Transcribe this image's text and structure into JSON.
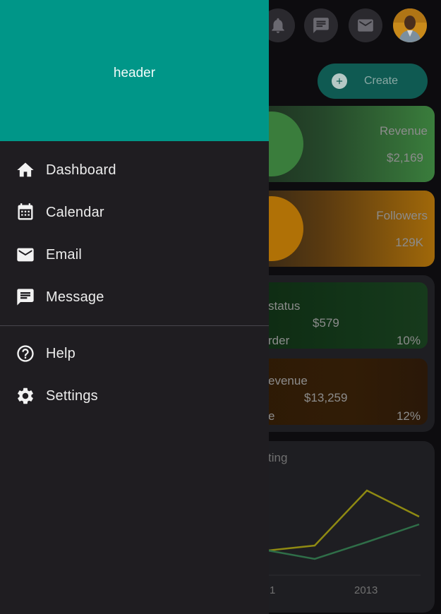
{
  "drawer": {
    "header_title": "header",
    "items": [
      {
        "label": "Dashboard",
        "icon": "home-icon"
      },
      {
        "label": "Calendar",
        "icon": "calendar-icon"
      },
      {
        "label": "Email",
        "icon": "email-icon"
      },
      {
        "label": "Message",
        "icon": "message-icon"
      }
    ],
    "secondary_items": [
      {
        "label": "Help",
        "icon": "help-icon"
      },
      {
        "label": "Settings",
        "icon": "settings-icon"
      }
    ],
    "header_color": "#009688",
    "background_color": "#1f1d21"
  },
  "topbar": {
    "icons": [
      "notifications-icon",
      "chat-icon",
      "mail-icon"
    ],
    "create_label": "Create"
  },
  "stats": {
    "revenue": {
      "label": "Revenue",
      "value": "$2,169"
    },
    "followers": {
      "label": "Followers",
      "value": "129K"
    }
  },
  "orders": {
    "status_title": "status",
    "status_value": "$579",
    "status_sub": "rder",
    "status_percent": "10%",
    "revenue_title": "evenue",
    "revenue_value": "$13,259",
    "revenue_sub": "e",
    "revenue_percent": "12%"
  },
  "chart": {
    "title": "ting",
    "x_tick_partial": "1",
    "x_tick_2013": "2013"
  }
}
